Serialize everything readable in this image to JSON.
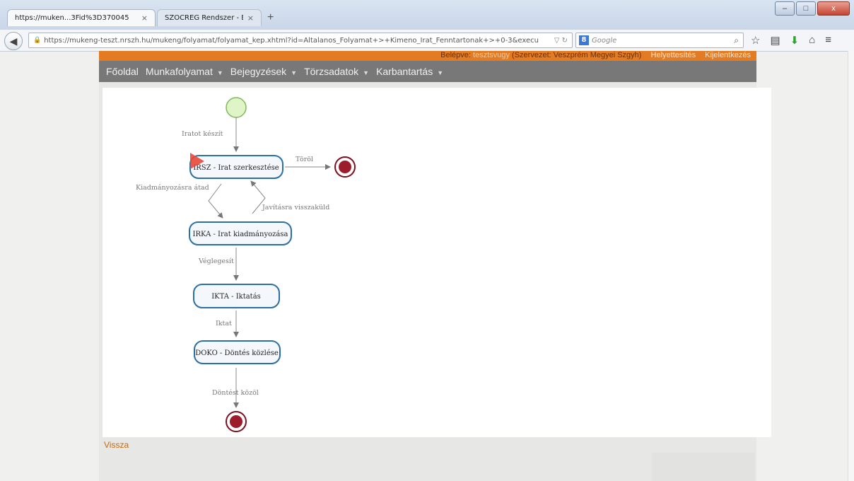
{
  "browser": {
    "tabs": [
      {
        "title": "https://muken...3Fid%3D370045",
        "active": true
      },
      {
        "title": "SZOCREG Rendszer - Bejelentk...",
        "active": false
      }
    ],
    "new_tab": "+",
    "close_glyph": "×",
    "url": "https://mukeng-teszt.nrszh.hu/mukeng/folyamat/folyamat_kep.xhtml?id=Altalanos_Folyamat+>+Kimeno_Irat_Fenntartonak+>+0-3&execu",
    "search_placeholder": "Google",
    "window_buttons": {
      "minimize": "–",
      "maximize": "□",
      "close": "x"
    }
  },
  "header": {
    "login_label": "Belépve:",
    "user": "tesztsvugy",
    "organization": "(Szervezet: Veszprém Megyei Szgyh)",
    "substitution_link": "Helyettesítés",
    "logout_link": "Kijelentkezés"
  },
  "menu": [
    {
      "label": "Főoldal",
      "has_dropdown": false
    },
    {
      "label": "Munkafolyamat",
      "has_dropdown": true
    },
    {
      "label": "Bejegyzések",
      "has_dropdown": true
    },
    {
      "label": "Törzsadatok",
      "has_dropdown": true
    },
    {
      "label": "Karbantartás",
      "has_dropdown": true
    }
  ],
  "diagram": {
    "nodes": [
      {
        "id": "irsz",
        "label": "IRSZ - Irat szerkesztése"
      },
      {
        "id": "irka",
        "label": "IRKA - Irat kiadmányozása"
      },
      {
        "id": "ikta",
        "label": "IKTA - Iktatás"
      },
      {
        "id": "doko",
        "label": "DOKO - Döntés közlése"
      }
    ],
    "edges": [
      {
        "label": "Iratot készít"
      },
      {
        "label": "Töröl"
      },
      {
        "label": "Kiadmányozásra átad"
      },
      {
        "label": "Javításra visszaküld"
      },
      {
        "label": "Véglegesít"
      },
      {
        "label": "Iktat"
      },
      {
        "label": "Döntést közöl"
      }
    ],
    "colors": {
      "task_border": "#2c6fa5",
      "task_fill": "#f4f8fc",
      "start_fill": "#dff5c8",
      "start_border": "#7fb85a",
      "end_fill": "#9c1c2c",
      "end_border": "#7a1020",
      "current_marker": "#e8483a"
    }
  },
  "back_link": "Vissza"
}
